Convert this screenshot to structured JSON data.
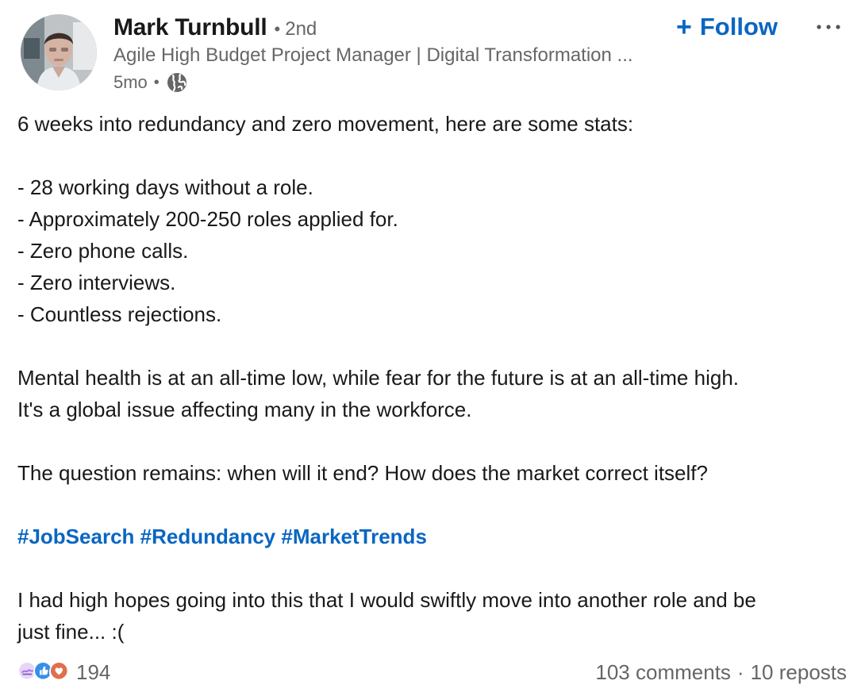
{
  "author": {
    "name": "Mark Turnbull",
    "connection_degree": "2nd",
    "headline": "Agile High Budget Project Manager | Digital Transformation ...",
    "timestamp": "5mo",
    "visibility_icon": "globe-icon"
  },
  "actions": {
    "follow_label": "Follow",
    "follow_icon": "plus-icon",
    "more_icon": "more-horizontal-icon"
  },
  "post": {
    "intro": "6 weeks into redundancy and zero movement, here are some stats:",
    "stats": [
      "- 28 working days without a role.",
      "- Approximately 200-250 roles applied for.",
      "- Zero phone calls.",
      "- Zero interviews.",
      "- Countless rejections."
    ],
    "paragraph_2_line_1": "Mental health is at an all-time low, while fear for the future is at an all-time high.",
    "paragraph_2_line_2": "It's a global issue affecting many in the workforce.",
    "paragraph_3": "The question remains: when will it end? How does the market correct itself?",
    "hashtags": [
      "#JobSearch",
      "#Redundancy",
      "#MarketTrends"
    ],
    "closing_line_1": "I had high hopes going into this that I would swiftly move into another role and be",
    "closing_line_2": "just fine... :("
  },
  "engagement": {
    "reaction_icons": [
      "support-icon",
      "like-icon",
      "love-icon"
    ],
    "reaction_count": "194",
    "comments": "103 comments",
    "separator": "·",
    "reposts": "10 reposts"
  },
  "colors": {
    "link_blue": "#0a66c2",
    "muted_text": "#666666",
    "body_text": "#191919",
    "like_blue": "#378fe9",
    "love_red": "#df704d",
    "support_purple": "#a872e8"
  }
}
